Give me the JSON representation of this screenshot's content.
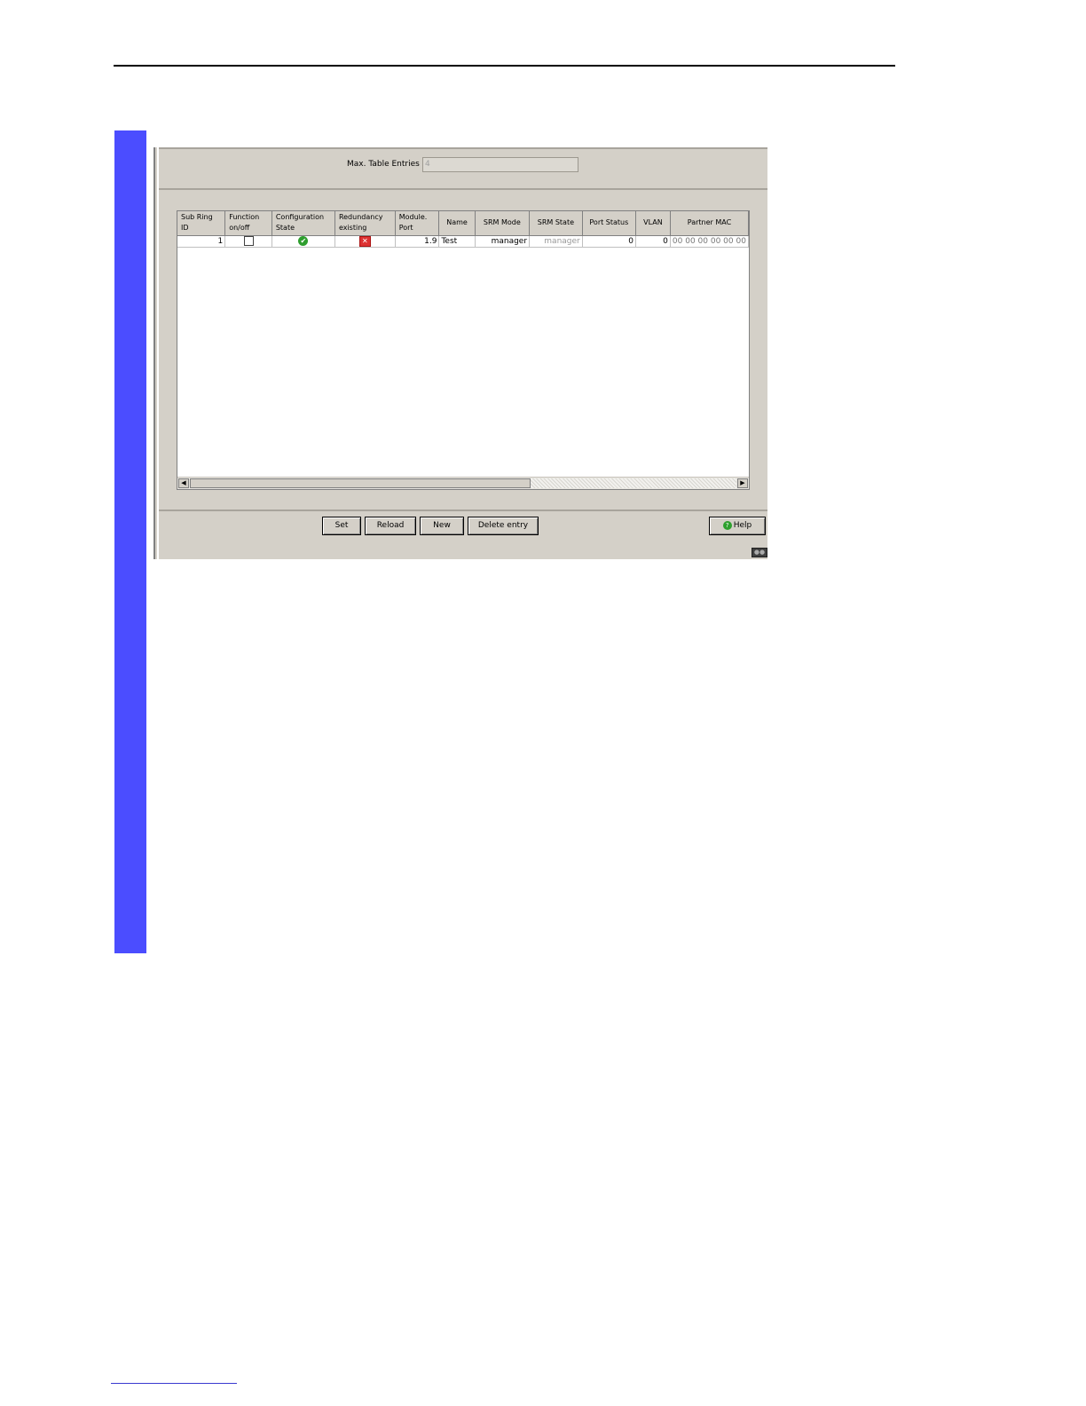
{
  "form": {
    "max_entries_label": "Max. Table Entries",
    "max_entries_value": "4"
  },
  "table": {
    "columns": [
      [
        "Sub Ring",
        "ID"
      ],
      [
        "Function",
        "on/off"
      ],
      [
        "Configuration",
        "State"
      ],
      [
        "Redundancy",
        "existing"
      ],
      [
        "Module.",
        "Port"
      ],
      [
        "Name"
      ],
      [
        "SRM Mode"
      ],
      [
        "SRM State"
      ],
      [
        "Port Status"
      ],
      [
        "VLAN"
      ],
      [
        "Partner MAC"
      ]
    ],
    "rows": [
      {
        "sub_ring_id": "1",
        "function_on": false,
        "configuration_state": "ok",
        "redundancy_existing": "no",
        "module_port": "1.9",
        "name": "Test",
        "srm_mode": "manager",
        "srm_state": "manager",
        "port_status": "0",
        "vlan": "0",
        "partner_mac": "00 00 00 00 00 00"
      }
    ]
  },
  "buttons": {
    "set": "Set",
    "reload": "Reload",
    "new": "New",
    "delete": "Delete entry",
    "help": "Help"
  },
  "icons": {
    "config_ok": "check-circle-icon",
    "redundancy_missing": "red-x-icon",
    "help": "help-icon",
    "status": "connection-status-icon"
  },
  "colors": {
    "side_bar": "#4b4dff",
    "window_bg": "#d4d0c8"
  }
}
